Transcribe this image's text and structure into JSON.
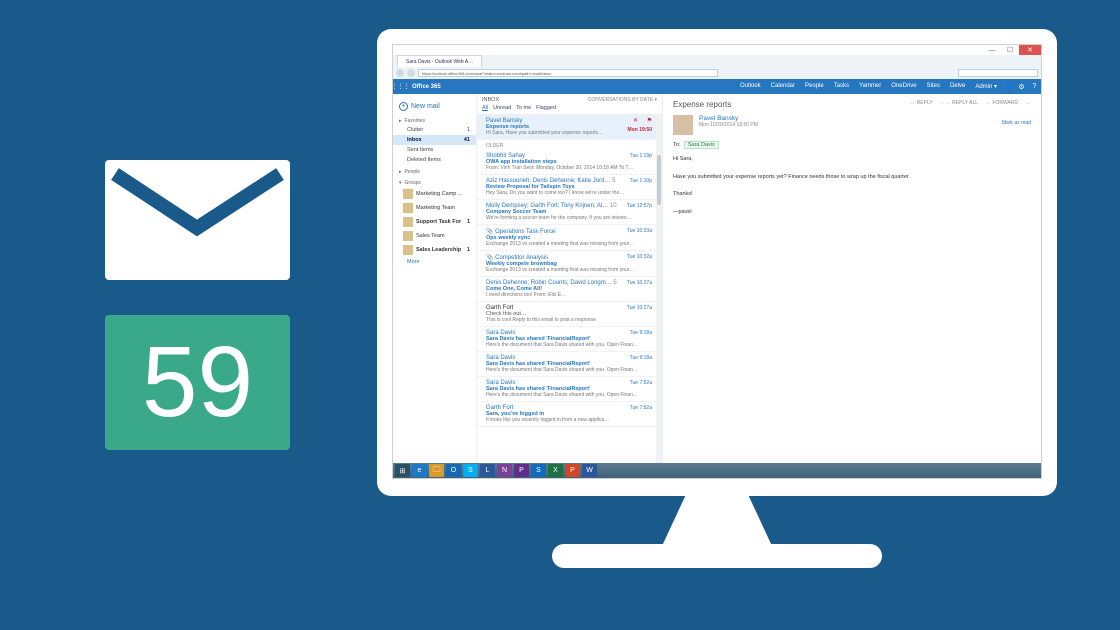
{
  "promo": {
    "count": "59"
  },
  "browser": {
    "tab": "Sara Davis - Outlook Web A…",
    "url": "https://outlook.office365.com/owa/?realm=contoso.com#path=/mail/inbox"
  },
  "o365": {
    "brand": "Office 365",
    "nav": [
      "Outlook",
      "Calendar",
      "People",
      "Tasks",
      "Yammer",
      "OneDrive",
      "Sites",
      "Delve",
      "Admin ▾"
    ]
  },
  "sidebar": {
    "new": "New mail",
    "favorites": "Favorites",
    "items": [
      {
        "label": "Clutter",
        "count": "1"
      },
      {
        "label": "Inbox",
        "count": "41",
        "active": true
      },
      {
        "label": "Sent Items",
        "count": ""
      },
      {
        "label": "Deleted Items",
        "count": ""
      }
    ],
    "people": "People",
    "groups": "Groups",
    "groupItems": [
      {
        "label": "Marketing Camp…"
      },
      {
        "label": "Marketing Team"
      },
      {
        "label": "Support Task For",
        "count": "1",
        "bold": true
      },
      {
        "label": "Sales Team"
      },
      {
        "label": "Sales Leadership",
        "count": "1",
        "bold": true
      }
    ],
    "more": "More"
  },
  "list": {
    "header": "INBOX",
    "sort": "CONVERSATIONS BY DATE ▾",
    "filters": [
      "All",
      "Unread",
      "To me",
      "Flagged"
    ],
    "sections": {
      "older": "OLDER"
    },
    "messages": [
      {
        "from": "Pavel Bansky",
        "subj": "Expense reports",
        "prev": "Hi Sara, Have you submitted your expense reports…",
        "time": "Mon 19:50",
        "sel": true
      },
      {
        "from": "Shobhit Sahay",
        "subj": "OWA app installation steps",
        "prev": "From: Vinh Tran Sent: Monday, October 20, 2014 10:18 AM To T…",
        "time": "Tue 1:19p"
      },
      {
        "from": "Aziz Hassouneh; Denis Dehenne; Katie Jord…",
        "subj": "Review Proposal for Tailspin Toys",
        "prev": "Hey Sara, Do you want to come too? I know we're under the…",
        "time": "Tue 1:10p",
        "count": "5"
      },
      {
        "from": "Molly Dempsey; Garth Fort; Tony Krijnen; Al…",
        "subj": "Company Soccer Team",
        "prev": "We're forming a soccer team for the company. If you are interes…",
        "time": "Tue 12:57p",
        "count": "10"
      },
      {
        "from": "Operations Task Force",
        "subj": "Ops weekly sync",
        "prev": "Exchange 2013 vs created a meeting that was missing from your…",
        "time": "Tue 10:33a",
        "icon": "📎"
      },
      {
        "from": "Competitor Analysis",
        "subj": "Weekly compete brownbag",
        "prev": "Exchange 2013 vs created a meeting that was missing from your…",
        "time": "Tue 10:32a",
        "icon": "📎"
      },
      {
        "from": "Denis Dehenne; Robin Counts; David Longm…",
        "subj": "Come One, Come All!",
        "prev": "I need directions too!                                    From: Eliz E…",
        "time": "Tue 10:27a",
        "count": "5"
      },
      {
        "from": "Garth Fort",
        "subj": "Check this out…",
        "prev": "This is cool Reply to this email to post a response",
        "time": "Tue 10:27a",
        "read": true
      },
      {
        "from": "Sara Davis",
        "subj": "Sara Davis has shared 'FinancialReport'",
        "prev": "Here's the document that Sara Davis shared with you. Open Finan…",
        "time": "Tue 9:18a"
      },
      {
        "from": "Sara Davis",
        "subj": "Sara Davis has shared 'FinancialReport'",
        "prev": "Here's the document that Sara Davis shared with you. Open Finan…",
        "time": "Tue 9:18a"
      },
      {
        "from": "Sara Davis",
        "subj": "Sara Davis has shared 'FinancialReport'",
        "prev": "Here's the document that Sara Davis shared with you. Open Finan…",
        "time": "Tue 7:52a"
      },
      {
        "from": "Garth Fort",
        "subj": "Sara, you've logged in",
        "prev": "It looks like you recently logged in from a new applica…",
        "time": "Tue 7:52a"
      }
    ]
  },
  "reading": {
    "title": "Expense reports",
    "actions": [
      "← REPLY",
      "←← REPLY ALL",
      "→ FORWARD",
      "…"
    ],
    "sender": "Pavel Bansky",
    "date": "Mon 10/20/2014 19:50 PM",
    "mark": "Mark as read",
    "toLabel": "To:",
    "to": "Sara Davis",
    "body": {
      "l1": "Hi Sara,",
      "l2": "Have you submitted your expense reports yet?  Finance needs those to wrap up the fiscal quarter.",
      "l3": "Thanks!",
      "l4": "—pavel"
    }
  },
  "taskbar": {
    "apps": [
      {
        "id": "win",
        "glyph": "⊞"
      },
      {
        "id": "ie",
        "glyph": "e"
      },
      {
        "id": "fold",
        "glyph": "🗀"
      },
      {
        "id": "ob",
        "glyph": "O"
      },
      {
        "id": "sk",
        "glyph": "S"
      },
      {
        "id": "ly",
        "glyph": "L"
      },
      {
        "id": "on",
        "glyph": "N"
      },
      {
        "id": "pp",
        "glyph": "P"
      },
      {
        "id": "sp",
        "glyph": "S"
      },
      {
        "id": "xl",
        "glyph": "X"
      },
      {
        "id": "ppt",
        "glyph": "P"
      },
      {
        "id": "wd",
        "glyph": "W"
      }
    ]
  }
}
